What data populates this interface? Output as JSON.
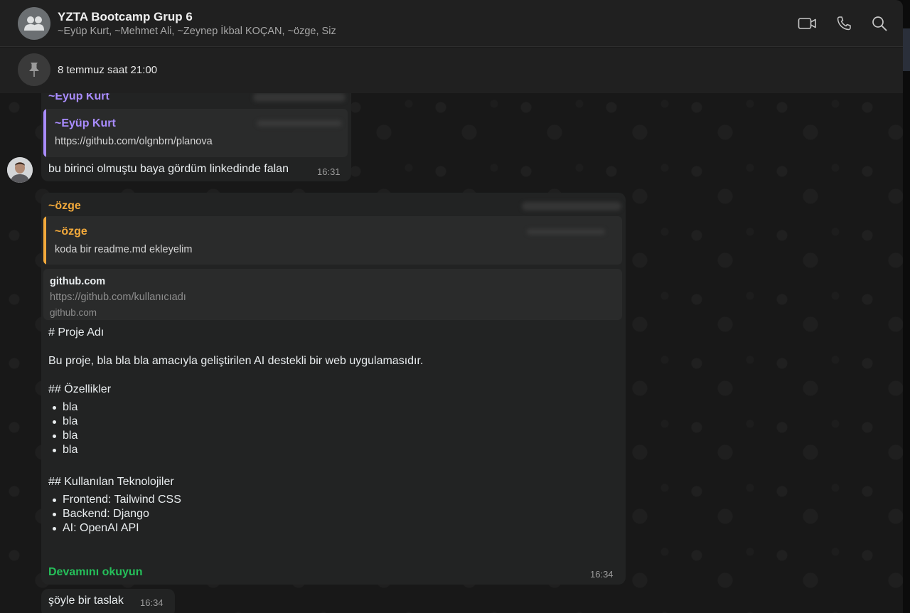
{
  "header": {
    "title": "YZTA Bootcamp Grup 6",
    "members": "~Eyüp Kurt, ~Mehmet Ali, ~Zeynep İkbal KOÇAN, ~özge, Siz",
    "icons": [
      "group-avatar-icon",
      "video-call-icon",
      "phone-icon",
      "search-icon"
    ]
  },
  "pinned": {
    "text": "8 temmuz saat 21:00",
    "icon": "pin-icon"
  },
  "messages": {
    "m1": {
      "sender": "~Eyüp Kurt",
      "quote_sender": "~Eyüp Kurt",
      "quote_text": "https://github.com/olgnbrn/planova",
      "text": "bu birinci olmuştu baya gördüm linkedinde falan",
      "time": "16:31"
    },
    "m2": {
      "sender": "~özge",
      "quote_sender": "~özge",
      "quote_text": "koda bir readme.md ekleyelim",
      "link_title": "github.com",
      "link_url": "https://github.com/kullanıcıadı",
      "link_domain": "github.com",
      "body": {
        "h1": "# Proje Adı",
        "desc": "Bu proje, bla bla bla amacıyla geliştirilen AI destekli bir web uygulamasıdır.",
        "h2a": "## Özellikler",
        "features": [
          "bla",
          "bla",
          "bla",
          "bla"
        ],
        "h2b": "## Kullanılan Teknolojiler",
        "tech": [
          "Frontend: Tailwind CSS",
          "Backend: Django",
          "AI: OpenAI API"
        ]
      },
      "read_more": "Devamını okuyun",
      "time": "16:34"
    },
    "m3": {
      "text": "şöyle bir taslak",
      "time": "16:34"
    }
  },
  "colors": {
    "eyup_name": "#a98cff",
    "ozge_name": "#f2a93b",
    "read_more": "#25c05a"
  }
}
